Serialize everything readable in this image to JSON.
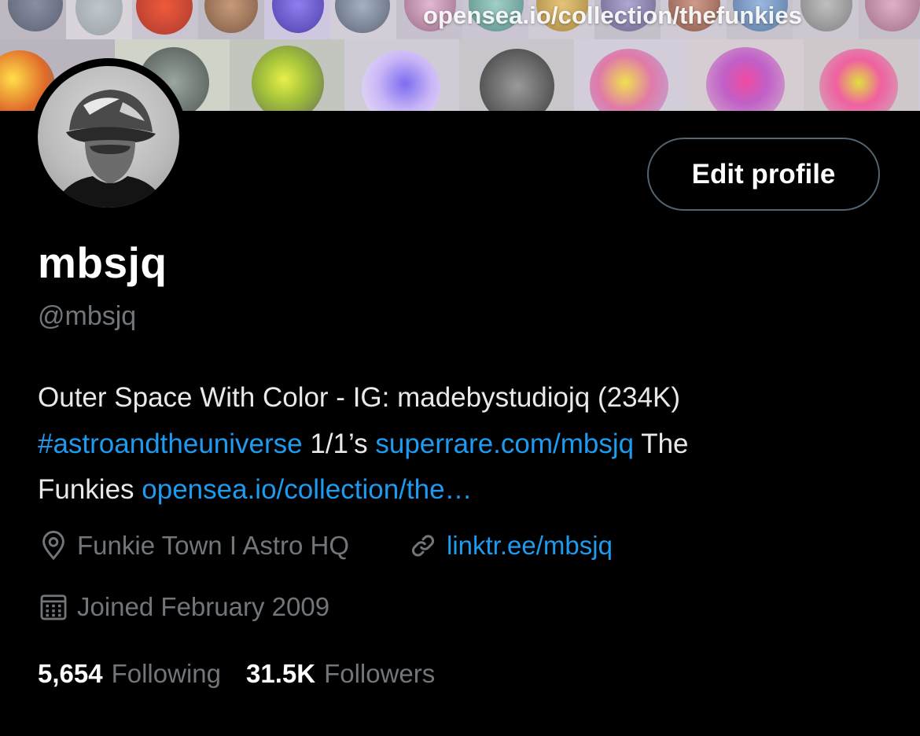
{
  "banner": {
    "overlay_url": "opensea.io/collection/thefunkies"
  },
  "profile": {
    "display_name": "mbsjq",
    "handle": "@mbsjq",
    "edit_button_label": "Edit profile",
    "bio": {
      "line1": "Outer Space With Color - IG: madebystudiojq (234K)",
      "hashtag": "#astroandtheuniverse",
      "text_ones": " 1/1’s ",
      "superrare_link": "superrare.com/mbsjq",
      "text_the": " The",
      "text_funkies": "Funkies ",
      "opensea_link": "opensea.io/collection/the…"
    },
    "location": "Funkie Town I Astro HQ",
    "website": "linktr.ee/mbsjq",
    "joined": "Joined February 2009",
    "following_count": "5,654",
    "following_label": "Following",
    "followers_count": "31.5K",
    "followers_label": "Followers"
  },
  "icons": {
    "location": "location-pin-icon",
    "website": "link-icon",
    "joined": "calendar-icon"
  },
  "colors": {
    "background": "#000000",
    "link": "#1d9bf0",
    "secondary_text": "#71767b",
    "primary_text": "#e7e9ea",
    "button_border": "#536471"
  }
}
